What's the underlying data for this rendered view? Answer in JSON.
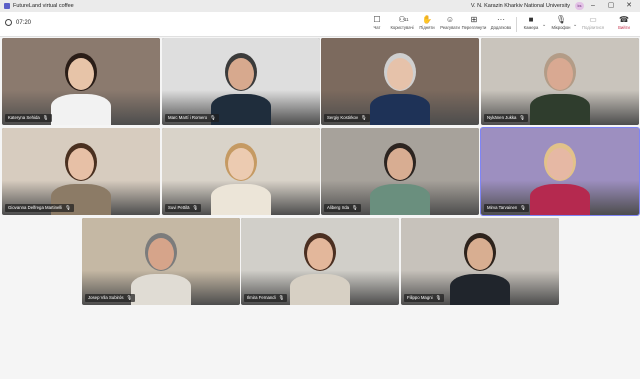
{
  "window": {
    "title": "FutureLand virtual coffee",
    "org": "V. N. Karazin Kharkiv National University",
    "avatar_initials": "ks",
    "controls": {
      "minimize": "–",
      "maximize": "▢",
      "close": "✕"
    }
  },
  "toolbar": {
    "timer": "07:20",
    "chat": "Чат",
    "people": "Користувачі",
    "people_count": "11",
    "raise": "Підняти",
    "react": "Реагувати",
    "view": "Переглянути",
    "more": "Додатково",
    "camera": "Камера",
    "mic": "Мікрофон",
    "share": "Поділитися",
    "leave": "Вийти"
  },
  "participants": [
    {
      "name": "Kateryna Sehida",
      "bg": "#8b7a6e",
      "skin": "#e7c4a8",
      "hair": "#2a1d17",
      "shirt": "#f2f2f2"
    },
    {
      "name": "Marc Martí i Romero",
      "bg": "#dedede",
      "skin": "#d7a98e",
      "hair": "#3b3b3b",
      "shirt": "#1f2d3c"
    },
    {
      "name": "Sergiy Kostirkov",
      "bg": "#7c6a5e",
      "skin": "#e6c2aa",
      "hair": "#cfcfcf",
      "shirt": "#1e3257"
    },
    {
      "name": "Nykänen Jukka",
      "bg": "#c9c4bc",
      "skin": "#d9a992",
      "hair": "#b39c87",
      "shirt": "#2f3d2d"
    },
    {
      "name": "Giovanna Delfrega Martinelli",
      "bg": "#d7ccbf",
      "skin": "#e7c0a6",
      "hair": "#4a3020",
      "shirt": "#8c7b66"
    },
    {
      "name": "Suvi Pettilä",
      "bg": "#d9d3c9",
      "skin": "#eccbb1",
      "hair": "#c59a63",
      "shirt": "#ece5d8"
    },
    {
      "name": "Aliberg Irda",
      "bg": "#a7a29b",
      "skin": "#d8ad92",
      "hair": "#2c2420",
      "shirt": "#6a8f7e"
    },
    {
      "name": "Mirva Tarvainen",
      "bg": "#9d8fc0",
      "skin": "#e6b8a4",
      "hair": "#e2c28a",
      "shirt": "#b5294f"
    },
    {
      "name": "Josep Vila Subirós",
      "bg": "#c5b8a4",
      "skin": "#d6a48a",
      "hair": "#7c7c7c",
      "shirt": "#e0dcd4"
    },
    {
      "name": "Ilmira Fernandi",
      "bg": "#d1cfc9",
      "skin": "#e3b79b",
      "hair": "#4b2f21",
      "shirt": "#d7d0c4"
    },
    {
      "name": "Filippo Magni",
      "bg": "#c7c2bb",
      "skin": "#d8ae91",
      "hair": "#2e231c",
      "shirt": "#20252c"
    }
  ],
  "colors": {
    "accent": "#5b5fc7",
    "leave": "#c4314b",
    "active_outline": "#7f85f5"
  }
}
